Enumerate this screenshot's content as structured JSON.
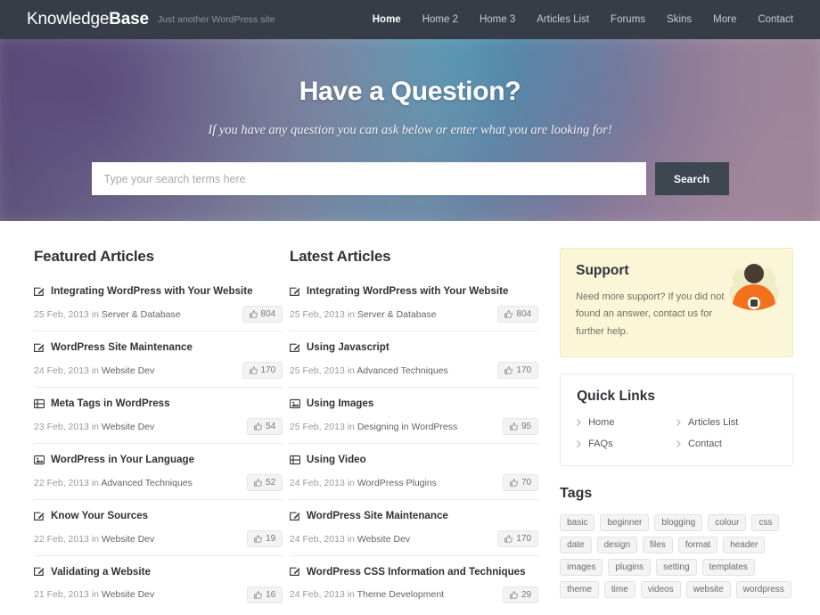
{
  "header": {
    "brand_light": "Knowledge",
    "brand_bold": "Base",
    "tagline": "Just another WordPress site",
    "nav": [
      {
        "label": "Home",
        "active": true
      },
      {
        "label": "Home 2",
        "active": false
      },
      {
        "label": "Home 3",
        "active": false
      },
      {
        "label": "Articles List",
        "active": false
      },
      {
        "label": "Forums",
        "active": false
      },
      {
        "label": "Skins",
        "active": false
      },
      {
        "label": "More",
        "active": false
      },
      {
        "label": "Contact",
        "active": false
      }
    ]
  },
  "hero": {
    "title": "Have a Question?",
    "subtitle": "If you have any question you can ask below or enter what you are looking for!",
    "search_placeholder": "Type your search terms here",
    "search_value": "",
    "search_button": "Search"
  },
  "featured": {
    "title": "Featured Articles",
    "articles": [
      {
        "icon": "edit-icon",
        "title": "Integrating WordPress with Your Website",
        "date": "25 Feb, 2013",
        "in": "in",
        "category": "Server & Database",
        "likes": "804"
      },
      {
        "icon": "edit-icon",
        "title": "WordPress Site Maintenance",
        "date": "24 Feb, 2013",
        "in": "in",
        "category": "Website Dev",
        "likes": "170"
      },
      {
        "icon": "list-icon",
        "title": "Meta Tags in WordPress",
        "date": "23 Feb, 2013",
        "in": "in",
        "category": "Website Dev",
        "likes": "54"
      },
      {
        "icon": "image-icon",
        "title": "WordPress in Your Language",
        "date": "22 Feb, 2013",
        "in": "in",
        "category": "Advanced Techniques",
        "likes": "52"
      },
      {
        "icon": "edit-icon",
        "title": "Know Your Sources",
        "date": "22 Feb, 2013",
        "in": "in",
        "category": "Website Dev",
        "likes": "19"
      },
      {
        "icon": "edit-icon",
        "title": "Validating a Website",
        "date": "21 Feb, 2013",
        "in": "in",
        "category": "Website Dev",
        "likes": "16"
      }
    ]
  },
  "latest": {
    "title": "Latest Articles",
    "articles": [
      {
        "icon": "edit-icon",
        "title": "Integrating WordPress with Your Website",
        "date": "25 Feb, 2013",
        "in": "in",
        "category": "Server & Database",
        "likes": "804"
      },
      {
        "icon": "edit-icon",
        "title": "Using Javascript",
        "date": "25 Feb, 2013",
        "in": "in",
        "category": "Advanced Techniques",
        "likes": "170"
      },
      {
        "icon": "image-icon",
        "title": "Using Images",
        "date": "25 Feb, 2013",
        "in": "in",
        "category": "Designing in WordPress",
        "likes": "95"
      },
      {
        "icon": "list-icon",
        "title": "Using Video",
        "date": "24 Feb, 2013",
        "in": "in",
        "category": "WordPress Plugins",
        "likes": "70"
      },
      {
        "icon": "edit-icon",
        "title": "WordPress Site Maintenance",
        "date": "24 Feb, 2013",
        "in": "in",
        "category": "Website Dev",
        "likes": "170"
      },
      {
        "icon": "edit-icon",
        "title": "WordPress CSS Information and Techniques",
        "date": "24 Feb, 2013",
        "in": "in",
        "category": "Theme Development",
        "likes": "29"
      }
    ]
  },
  "sidebar": {
    "support": {
      "title": "Support",
      "text": "Need more support? If you did not found an answer, contact us for further help.",
      "illustration": "support-person-icon",
      "bg_color": "#fbf6d8",
      "person_body_color": "#f3701c",
      "person_head_color": "#4a3b30"
    },
    "quick_links": {
      "title": "Quick Links",
      "items": [
        {
          "label": "Home"
        },
        {
          "label": "Articles List"
        },
        {
          "label": "FAQs"
        },
        {
          "label": "Contact"
        }
      ]
    },
    "tags": {
      "title": "Tags",
      "items": [
        "basic",
        "beginner",
        "blogging",
        "colour",
        "css",
        "date",
        "design",
        "files",
        "format",
        "header",
        "images",
        "plugins",
        "setting",
        "templates",
        "theme",
        "time",
        "videos",
        "website",
        "wordpress"
      ]
    }
  },
  "theme": {
    "header_bg": "#373d47",
    "search_button_bg": "#3e4650",
    "text_dark": "#2f3237",
    "muted": "#9b9b9b"
  }
}
